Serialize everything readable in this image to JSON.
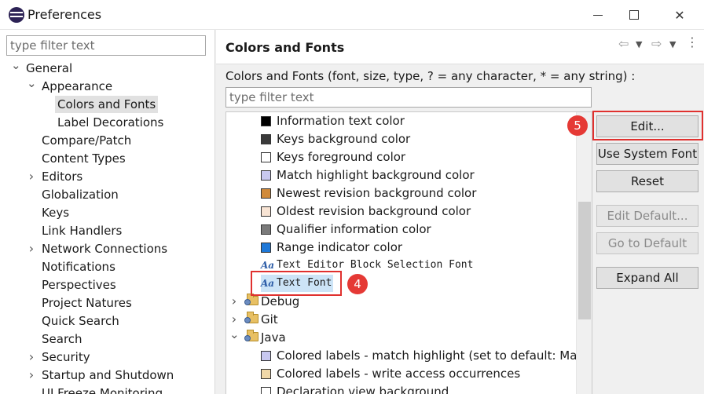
{
  "window": {
    "title": "Preferences"
  },
  "left": {
    "filter_placeholder": "type filter text",
    "tree": [
      {
        "label": "General",
        "twisty": "⌄",
        "indent": 0
      },
      {
        "label": "Appearance",
        "twisty": "⌄",
        "indent": 1
      },
      {
        "label": "Colors and Fonts",
        "twisty": "",
        "indent": 2,
        "selected": true
      },
      {
        "label": "Label Decorations",
        "twisty": "",
        "indent": 2
      },
      {
        "label": "Compare/Patch",
        "twisty": "",
        "indent": 1
      },
      {
        "label": "Content Types",
        "twisty": "",
        "indent": 1
      },
      {
        "label": "Editors",
        "twisty": "›",
        "indent": 1
      },
      {
        "label": "Globalization",
        "twisty": "",
        "indent": 1
      },
      {
        "label": "Keys",
        "twisty": "",
        "indent": 1
      },
      {
        "label": "Link Handlers",
        "twisty": "",
        "indent": 1
      },
      {
        "label": "Network Connections",
        "twisty": "›",
        "indent": 1
      },
      {
        "label": "Notifications",
        "twisty": "",
        "indent": 1
      },
      {
        "label": "Perspectives",
        "twisty": "",
        "indent": 1
      },
      {
        "label": "Project Natures",
        "twisty": "",
        "indent": 1
      },
      {
        "label": "Quick Search",
        "twisty": "",
        "indent": 1
      },
      {
        "label": "Search",
        "twisty": "",
        "indent": 1
      },
      {
        "label": "Security",
        "twisty": "›",
        "indent": 1
      },
      {
        "label": "Startup and Shutdown",
        "twisty": "›",
        "indent": 1
      },
      {
        "label": "UI Freeze Monitoring",
        "twisty": "",
        "indent": 1
      }
    ]
  },
  "right": {
    "title": "Colors and Fonts",
    "description": "Colors and Fonts (font, size, type, ? = any character, * = any string) :",
    "filter_placeholder": "type filter text",
    "items": [
      {
        "kind": "color",
        "label": "Information text color",
        "color": "#000000"
      },
      {
        "kind": "color",
        "label": "Keys background color",
        "color": "#3a3a3a"
      },
      {
        "kind": "color",
        "label": "Keys foreground color",
        "color": "#ffffff"
      },
      {
        "kind": "color",
        "label": "Match highlight background color",
        "color": "#c8c8f0"
      },
      {
        "kind": "color",
        "label": "Newest revision background color",
        "color": "#d08a3a"
      },
      {
        "kind": "color",
        "label": "Oldest revision background color",
        "color": "#f8e4d4"
      },
      {
        "kind": "color",
        "label": "Qualifier information color",
        "color": "#7a7a7a"
      },
      {
        "kind": "color",
        "label": "Range indicator color",
        "color": "#1e78d8"
      },
      {
        "kind": "font",
        "label": "Text Editor Block Selection Font"
      },
      {
        "kind": "font",
        "label": "Text Font",
        "selected": true
      },
      {
        "kind": "category",
        "label": "Debug",
        "twisty": "›"
      },
      {
        "kind": "category",
        "label": "Git",
        "twisty": "›"
      },
      {
        "kind": "category",
        "label": "Java",
        "twisty": "⌄"
      },
      {
        "kind": "color",
        "label": "Colored labels - match highlight (set to default: Matc",
        "color": "#c8c8f0"
      },
      {
        "kind": "color",
        "label": "Colored labels - write access occurrences",
        "color": "#f0d8a8"
      },
      {
        "kind": "color",
        "label": "Declaration view background",
        "color": "#ffffff"
      }
    ],
    "buttons": {
      "edit": "Edit...",
      "use_system_font": "Use System Font",
      "reset": "Reset",
      "edit_default": "Edit Default...",
      "go_to_default": "Go to Default",
      "expand_all": "Expand All"
    }
  },
  "annotations": {
    "text_font_badge": "4",
    "edit_badge": "5"
  },
  "colors": {
    "highlight": "#e0312f",
    "badge": "#e53935",
    "selection": "#cce4f7"
  }
}
